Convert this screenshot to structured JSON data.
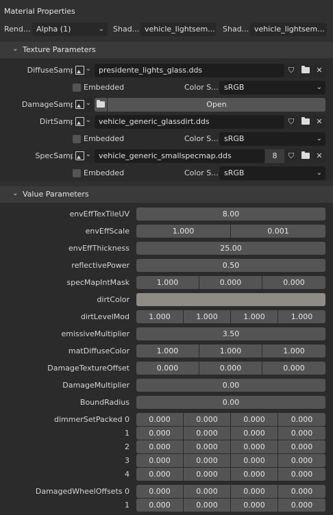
{
  "panel_title": "Material Properties",
  "top_row": {
    "render_label": "Rend...",
    "render_value": "Alpha (1)",
    "shader_label_1": "Shad...",
    "shader_value_1": "vehicle_lightsem...",
    "shader_label_2": "Shad...",
    "shader_value_2": "vehicle_lightsem..."
  },
  "texture_section": {
    "title": "Texture Parameters",
    "embedded_label": "Embedded",
    "colorspace_label": "Color S...",
    "open_label": "Open",
    "samplers": [
      {
        "label": "DiffuseSampler",
        "file": "presidente_lights_glass.dds",
        "colorspace": "sRGB"
      },
      {
        "label": "DamageSampler"
      },
      {
        "label": "DirtSampler",
        "file": "vehicle_generic_glassdirt.dds",
        "colorspace": "sRGB"
      },
      {
        "label": "SpecSampler",
        "file": "vehicle_generic_smallspecmap.dds",
        "count": "8",
        "colorspace": "sRGB"
      }
    ]
  },
  "value_section": {
    "title": "Value Parameters",
    "rows": [
      {
        "label": "envEffTexTileUV",
        "values": [
          "8.00"
        ]
      },
      {
        "label": "envEffScale",
        "values": [
          "1.000",
          "0.001"
        ]
      },
      {
        "label": "envEffThickness",
        "values": [
          "25.00"
        ]
      },
      {
        "label": "reflectivePower",
        "values": [
          "0.50"
        ]
      },
      {
        "label": "specMapIntMask",
        "values": [
          "1.000",
          "0.000",
          "0.000"
        ]
      },
      {
        "label": "dirtColor",
        "color": "#8f8c86"
      },
      {
        "label": "dirtLevelMod",
        "values": [
          "1.000",
          "1.000",
          "1.000",
          "1.000"
        ]
      },
      {
        "label": "emissiveMultiplier",
        "values": [
          "3.50"
        ]
      },
      {
        "label": "matDiffuseColor",
        "values": [
          "1.000",
          "1.000",
          "1.000"
        ]
      },
      {
        "label": "DamageTextureOffset",
        "values": [
          "0.000",
          "0.000",
          "0.000"
        ]
      },
      {
        "label": "DamageMultiplier",
        "values": [
          "0.00"
        ]
      },
      {
        "label": "BoundRadius",
        "values": [
          "0.00"
        ]
      },
      {
        "label": "dimmerSetPacked 0",
        "values": [
          "0.000",
          "0.000",
          "0.000",
          "0.000"
        ]
      },
      {
        "label": "1",
        "values": [
          "0.000",
          "0.000",
          "0.000",
          "0.000"
        ]
      },
      {
        "label": "2",
        "values": [
          "0.000",
          "0.000",
          "0.000",
          "0.000"
        ]
      },
      {
        "label": "3",
        "values": [
          "0.000",
          "0.000",
          "0.000",
          "0.000"
        ]
      },
      {
        "label": "4",
        "values": [
          "0.000",
          "0.000",
          "0.000",
          "0.000"
        ]
      },
      {
        "label": "DamagedWheelOffsets 0",
        "values": [
          "0.000",
          "0.000",
          "0.000",
          "0.000"
        ]
      },
      {
        "label": "1",
        "values": [
          "0.000",
          "0.000",
          "0.000",
          "0.000"
        ]
      }
    ]
  },
  "icons": {
    "image": "image-icon",
    "shield": "shield-icon",
    "folder": "folder-icon",
    "close": "close-icon",
    "chevron": "chevron-down-icon"
  }
}
